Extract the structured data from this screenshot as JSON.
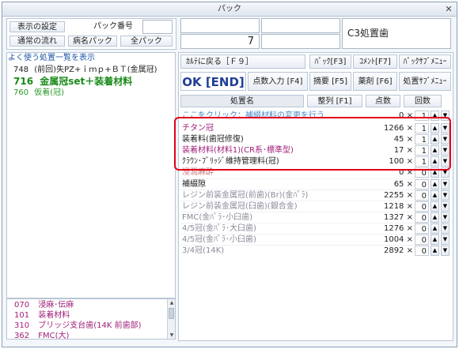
{
  "window": {
    "title": "パック",
    "close_glyph": "✕"
  },
  "top_left": {
    "btn_settings": "表示の設定",
    "lbl_pack_no": "パック番号",
    "pack_no_value": "",
    "btn_normal_flow": "通常の流れ",
    "btn_disease_pack": "病名パック",
    "btn_all_pack": "全パック"
  },
  "top_center": {
    "field1": "",
    "field2": "",
    "field3": "",
    "field4": "7",
    "field5": "",
    "field6": "C3処置歯"
  },
  "left_list": {
    "header": "よく使う処置一覧を表示",
    "items": [
      {
        "code": "748",
        "label": "(前回)失PZ+ｉｍｐ+ＢＴ(金属冠)"
      },
      {
        "code": "716",
        "label": "金属冠set＋装着材料"
      },
      {
        "code": "760",
        "label": "仮着(冠)"
      }
    ]
  },
  "bottom_list": {
    "items": [
      {
        "code": "070",
        "label": "浸麻･伝麻"
      },
      {
        "code": "101",
        "label": "装着材料"
      },
      {
        "code": "310",
        "label": "ブリッジ支台歯(14K 前歯部)"
      },
      {
        "code": "362",
        "label": "FMC(大)"
      }
    ]
  },
  "toolbar": {
    "karte_back": "ｶﾙﾃに戻る［Ｆ９］",
    "pack_f3": "ﾊﾟｯｸ[F3]",
    "comment_f7": "ｺﾒﾝﾄ[F7]",
    "pack_sub_menu": "ﾊﾟｯｸｻﾌﾞﾒﾆｭｰ",
    "ok_end": "OK [END]",
    "points_f4": "点数入力 [F4]",
    "summary_f5": "摘要 [F5]",
    "drug_f6": "薬剤 [F6]",
    "treatment_sub_menu": "処置ｻﾌﾞﾒﾆｭｰ"
  },
  "columns": {
    "name": "処置名",
    "sort_f1": "整列 [F1]",
    "points": "点数",
    "count": "回数"
  },
  "hint_row": {
    "label": "ここをクリック：補綴材料の変更を行う",
    "qty": "0",
    "mult": "×",
    "count": "1"
  },
  "rows": [
    {
      "name": "チタン冠",
      "qty": "1266",
      "count": "1",
      "highlight": true,
      "color": "#a0207a"
    },
    {
      "name": "装着料(歯冠修復)",
      "qty": "45",
      "count": "1",
      "highlight": true,
      "color": "#222222"
    },
    {
      "name": "装着材料(材料1)(CR系･標準型)",
      "qty": "17",
      "count": "1",
      "highlight": true,
      "color": "#a0207a"
    },
    {
      "name": "ｸﾗｳﾝ･ﾌﾞﾘｯｼﾞ維持管理料(冠)",
      "qty": "100",
      "count": "1",
      "highlight": true,
      "color": "#222222"
    },
    {
      "name": "浸潤麻酔",
      "qty": "0",
      "count": "0",
      "highlight": false,
      "color": "#c87c7c"
    },
    {
      "name": "補綴隙",
      "qty": "65",
      "count": "0",
      "highlight": false,
      "color": "#222222"
    },
    {
      "name": "レジン前装金属冠(前歯)(Br)(金ﾊﾟﾗ)",
      "qty": "2255",
      "count": "0",
      "highlight": false,
      "color": "#8a8a9a"
    },
    {
      "name": "レジン前装金属冠(臼歯)(銀合金)",
      "qty": "1218",
      "count": "0",
      "highlight": false,
      "color": "#8a8a9a"
    },
    {
      "name": "FMC(金ﾊﾟﾗ･小臼歯)",
      "qty": "1327",
      "count": "0",
      "highlight": false,
      "color": "#8a8a9a"
    },
    {
      "name": "4/5冠(金ﾊﾟﾗ･大臼歯)",
      "qty": "1276",
      "count": "0",
      "highlight": false,
      "color": "#8a8a9a"
    },
    {
      "name": "4/5冠(金ﾊﾟﾗ･小臼歯)",
      "qty": "1004",
      "count": "0",
      "highlight": false,
      "color": "#8a8a9a"
    },
    {
      "name": "3/4冠(14K)",
      "qty": "2892",
      "count": "0",
      "highlight": false,
      "color": "#8a8a9a"
    }
  ],
  "glyphs": {
    "mult": "×",
    "up": "▲",
    "down": "▼"
  },
  "colors": {
    "highlight_border": "#e0001b",
    "list_selected": "#1a8a1a",
    "list_alt": "#a0207a"
  }
}
